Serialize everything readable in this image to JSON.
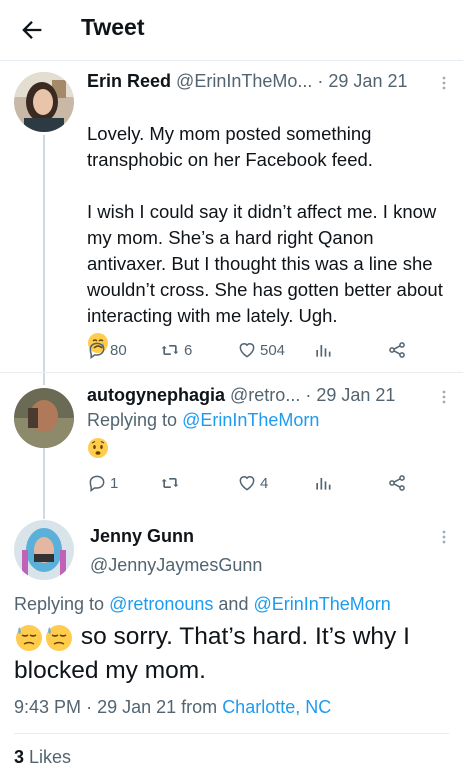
{
  "header": {
    "title": "Tweet",
    "back_icon": "arrow-left-icon"
  },
  "tweets": [
    {
      "name": "Erin Reed",
      "handle": "@ErinInTheMo...",
      "dot": "·",
      "date": "29 Jan 21",
      "text": "Lovely. My mom posted something transphobic on her Facebook feed.\n\nI wish I could say it didn’t affect me. I know my mom. She’s a hard right Qanon antivaxer. But I thought this was a line she wouldn’t cross. She has gotten better about interacting with me lately. Ugh.",
      "emoji": "crying-face",
      "replies": "80",
      "retweets": "6",
      "likes": "504"
    },
    {
      "name": "autogynephagia",
      "handle": "@retro...",
      "dot": "·",
      "date": "29 Jan 21",
      "replying_prefix": "Replying to",
      "replying_to": "@ErinInTheMorn",
      "emoji": "worried-face",
      "replies": "1",
      "retweets": "",
      "likes": "4"
    }
  ],
  "main_tweet": {
    "name": "Jenny Gunn",
    "handle": "@JennyJaymesGunn",
    "replying_prefix": "Replying to",
    "replying_to_1": "@retronouns",
    "replying_and": "and",
    "replying_to_2": "@ErinInTheMorn",
    "text": "so sorry. That’s hard. It’s why I blocked my mom.",
    "emoji": "downcast-face-with-sweat",
    "time": "9:43 PM",
    "dot": "·",
    "date": "29 Jan 21",
    "from": "from",
    "location": "Charlotte, NC",
    "likes_count": "3",
    "likes_label": "Likes"
  },
  "colors": {
    "accent": "#1d9bf0",
    "muted": "#536471",
    "text": "#0f1419",
    "divider": "#e6ecf0"
  }
}
